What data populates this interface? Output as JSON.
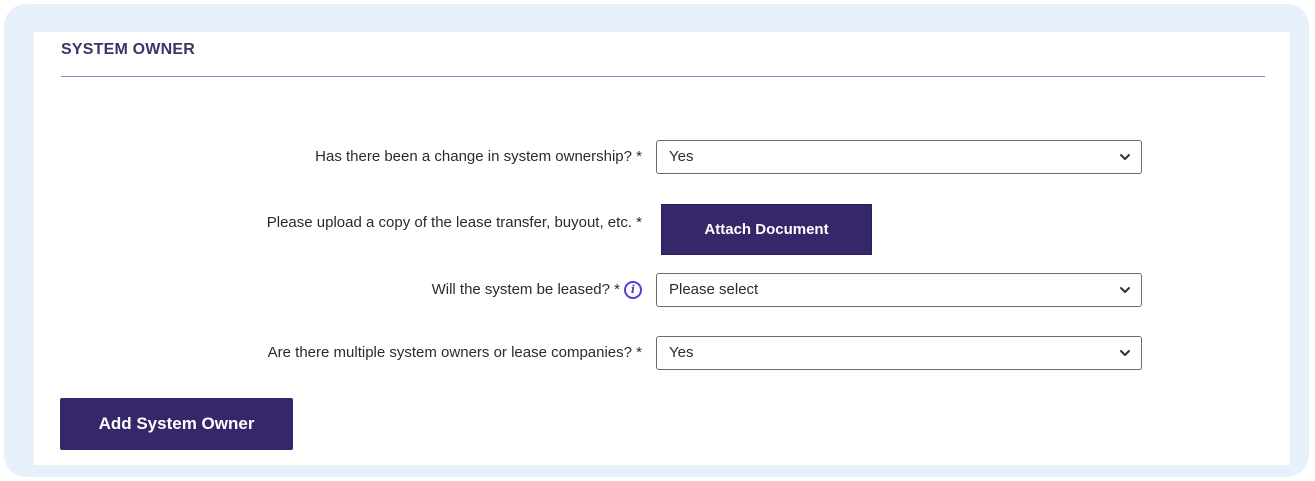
{
  "section": {
    "title": "SYSTEM OWNER"
  },
  "fields": {
    "ownership_change": {
      "label": "Has there been a change in system ownership? *",
      "value": "Yes"
    },
    "upload": {
      "label": "Please upload a copy of the lease transfer, buyout, etc. *",
      "button_label": "Attach Document"
    },
    "leased": {
      "label": "Will the system be leased? *",
      "value": "Please select",
      "info_icon": "info-icon"
    },
    "multiple_owners": {
      "label": "Are there multiple system owners or lease companies? *",
      "value": "Yes"
    }
  },
  "actions": {
    "add_owner_label": "Add System Owner"
  },
  "colors": {
    "accent": "#35276a",
    "panel_background": "#e8f1fb",
    "info_icon": "#5b3bd1",
    "title": "#3a3566"
  }
}
